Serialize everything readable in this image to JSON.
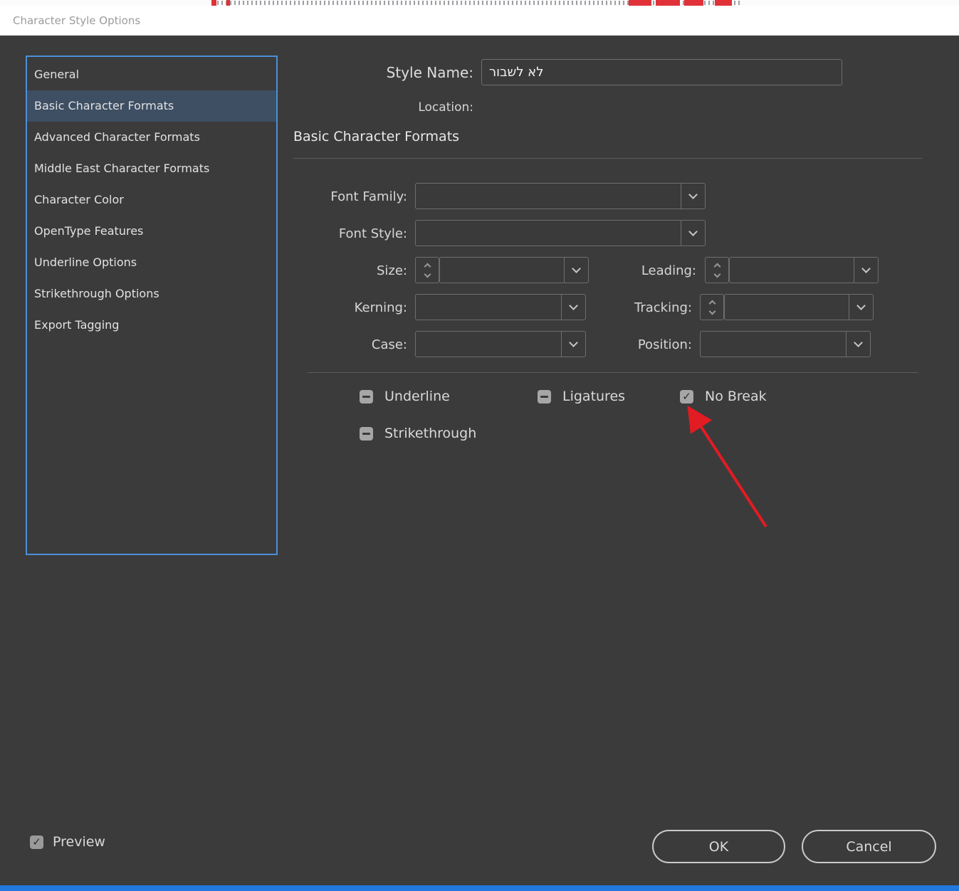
{
  "colors": {
    "dialog_bg": "#3b3b3b",
    "titlebar_bg": "#ffffff",
    "titlebar_text": "#9b9b9b",
    "sidebar_border_blue": "#4a90d9",
    "sidebar_selected_bg": "#3e4e63",
    "annotation_arrow_red": "#e31b23",
    "bottom_bar_blue": "#2278dd"
  },
  "titlebar": {
    "title": "Character Style Options"
  },
  "sidebar": {
    "items": [
      {
        "label": "General",
        "selected": false
      },
      {
        "label": "Basic Character Formats",
        "selected": true
      },
      {
        "label": "Advanced Character Formats",
        "selected": false
      },
      {
        "label": "Middle East Character Formats",
        "selected": false
      },
      {
        "label": "Character Color",
        "selected": false
      },
      {
        "label": "OpenType Features",
        "selected": false
      },
      {
        "label": "Underline Options",
        "selected": false
      },
      {
        "label": "Strikethrough Options",
        "selected": false
      },
      {
        "label": "Export Tagging",
        "selected": false
      }
    ]
  },
  "header": {
    "style_name_label": "Style Name:",
    "style_name_value": "לא לשבור",
    "location_label": "Location:",
    "section_title": "Basic Character Formats"
  },
  "form": {
    "font_family": {
      "label": "Font Family:",
      "value": ""
    },
    "font_style": {
      "label": "Font Style:",
      "value": ""
    },
    "size": {
      "label": "Size:",
      "value": ""
    },
    "leading": {
      "label": "Leading:",
      "value": ""
    },
    "kerning": {
      "label": "Kerning:",
      "value": ""
    },
    "tracking": {
      "label": "Tracking:",
      "value": ""
    },
    "case": {
      "label": "Case:",
      "value": ""
    },
    "position": {
      "label": "Position:",
      "value": ""
    }
  },
  "checkboxes": {
    "underline": {
      "label": "Underline",
      "state": "indeterminate"
    },
    "ligatures": {
      "label": "Ligatures",
      "state": "indeterminate"
    },
    "no_break": {
      "label": "No Break",
      "state": "checked"
    },
    "strikethrough": {
      "label": "Strikethrough",
      "state": "indeterminate"
    }
  },
  "footer": {
    "preview": {
      "label": "Preview",
      "state": "checked"
    },
    "ok_label": "OK",
    "cancel_label": "Cancel"
  },
  "icons": {
    "combo_arrow": "chevron-down",
    "stepper_icons": "chevron-up / chevron-down",
    "checkbox_checked_glyph": "✓"
  }
}
